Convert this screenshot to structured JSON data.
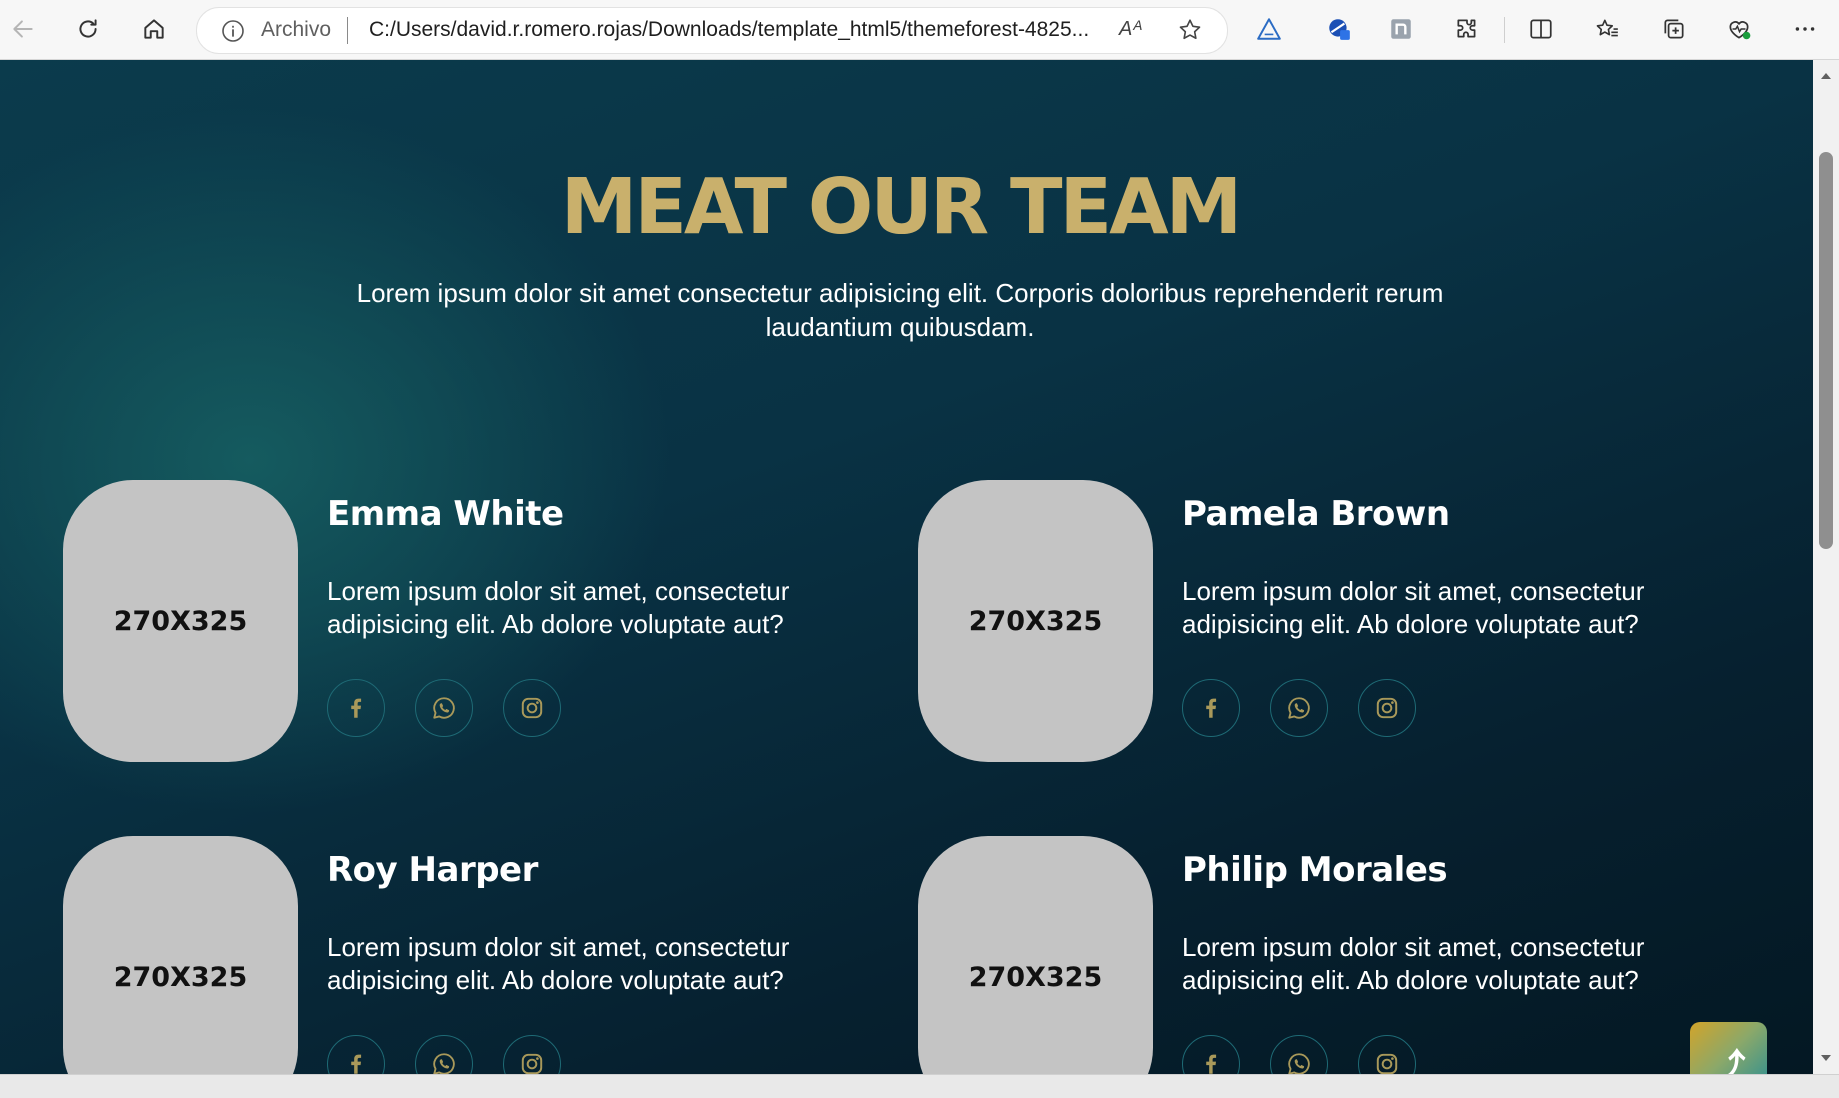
{
  "browser": {
    "address_scheme": "Archivo",
    "address_url": "C:/Users/david.r.romero.rojas/Downloads/template_html5/themeforest-4825...",
    "read_aloud_label": "Aᴬ"
  },
  "page": {
    "title": "MEAT OUR TEAM",
    "subtitle": "Lorem ipsum dolor sit amet consectetur adipisicing elit. Corporis doloribus reprehenderit rerum laudantium quibusdam.",
    "back_to_top_label": "⤴",
    "team": [
      {
        "photo_label": "270X325",
        "name": "Emma White",
        "description": "Lorem ipsum dolor sit amet, consectetur adipisicing elit. Ab dolore voluptate aut?"
      },
      {
        "photo_label": "270X325",
        "name": "Pamela Brown",
        "description": "Lorem ipsum dolor sit amet, consectetur adipisicing elit. Ab dolore voluptate aut?"
      },
      {
        "photo_label": "270X325",
        "name": "Roy Harper",
        "description": "Lorem ipsum dolor sit amet, consectetur adipisicing elit. Ab dolore voluptate aut?"
      },
      {
        "photo_label": "270X325",
        "name": "Philip Morales",
        "description": "Lorem ipsum dolor sit amet, consectetur adipisicing elit. Ab dolore voluptate aut?"
      }
    ],
    "social_icons": [
      "facebook-icon",
      "whatsapp-icon",
      "instagram-icon"
    ]
  },
  "colors": {
    "title_gold": "#c9b06c",
    "icon_gold": "#a9995a",
    "bg_dark": "#06202f",
    "bg_teal": "#155b5f"
  }
}
